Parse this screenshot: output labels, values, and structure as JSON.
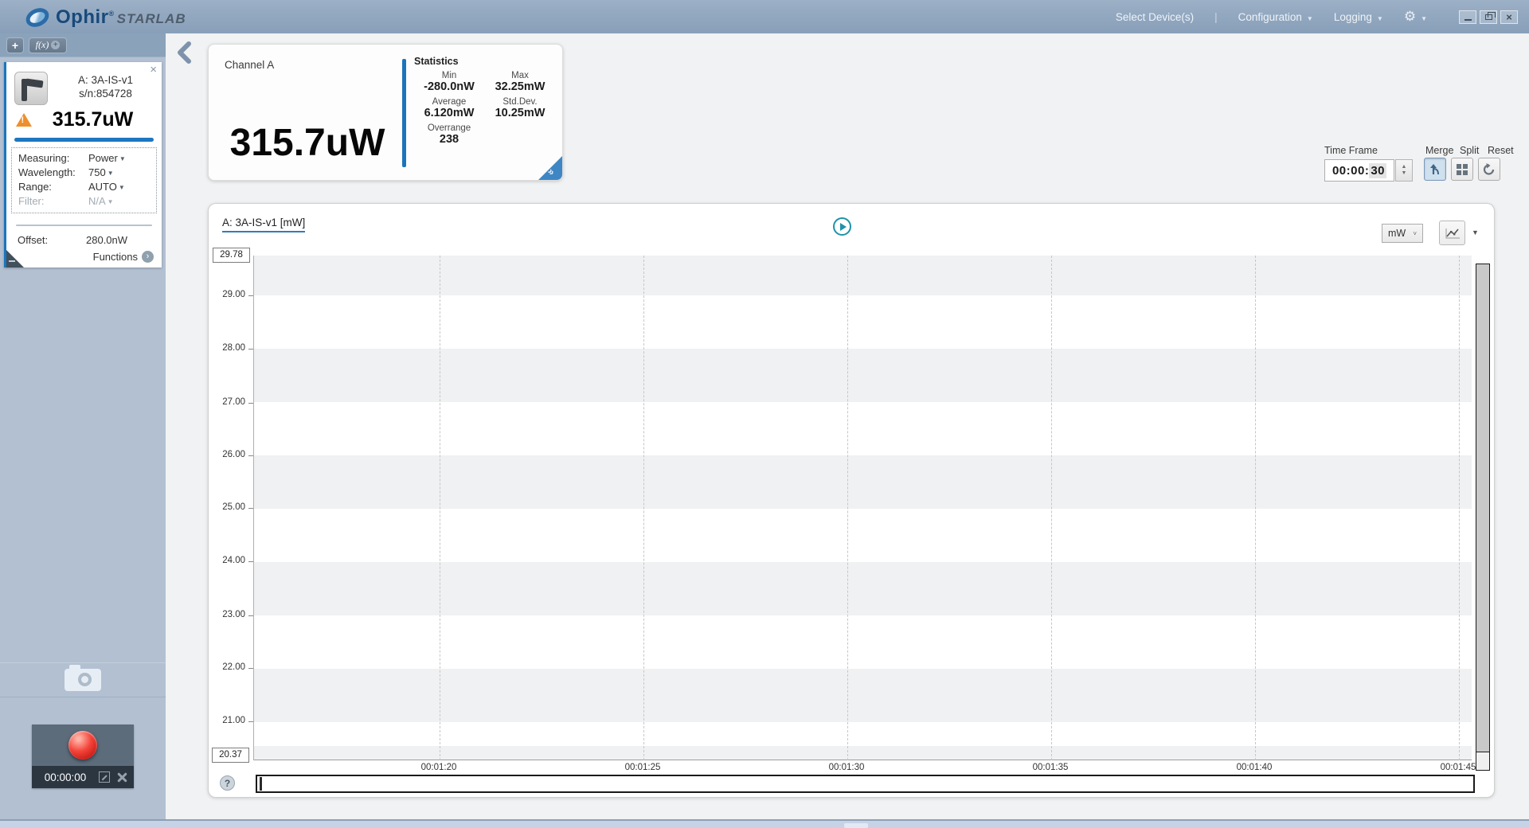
{
  "titlebar": {
    "brand": "Ophir",
    "registered": "®",
    "brand_sub": "STARLAB",
    "select_devices": "Select Device(s)",
    "separator": "|",
    "configuration": "Configuration",
    "logging": "Logging"
  },
  "icons": {
    "caret_down": "▼",
    "gear": "⚙",
    "close_window": "×",
    "chevron_right": "›",
    "plus": "+",
    "fx": "f(x)",
    "help": "?",
    "collapse_arrows": "»"
  },
  "sidebar": {
    "device": {
      "close": "×",
      "name": "A: 3A-IS-v1",
      "serial": "s/n:854728",
      "warning": "!",
      "reading": "315.7uW",
      "settings": [
        {
          "label": "Measuring:",
          "value": "Power"
        },
        {
          "label": "Wavelength:",
          "value": "750"
        },
        {
          "label": "Range:",
          "value": "AUTO"
        },
        {
          "label": "Filter:",
          "value": "N/A"
        }
      ],
      "offset_label": "Offset:",
      "offset_value": "280.0nW",
      "functions_label": "Functions"
    },
    "recorder": {
      "elapsed": "00:00:00"
    }
  },
  "main": {
    "channel_card": {
      "title": "Channel A",
      "reading": "315.7uW",
      "stats_title": "Statistics",
      "stats": [
        {
          "label": "Min",
          "value": "-280.0nW"
        },
        {
          "label": "Max",
          "value": "32.25mW"
        },
        {
          "label": "Average",
          "value": "6.120mW"
        },
        {
          "label": "Std.Dev.",
          "value": "10.25mW"
        },
        {
          "label": "Overrange",
          "value": "238"
        }
      ]
    },
    "timeframe": {
      "label": "Time Frame",
      "value_main": "00:00:",
      "value_seconds": "30",
      "merge_label": "Merge",
      "split_label": "Split",
      "reset_label": "Reset"
    },
    "chart": {
      "title": "A: 3A-IS-v1 [mW]",
      "unit": "mW"
    }
  },
  "chart_data": {
    "type": "line",
    "title": "A: 3A-IS-v1 [mW]",
    "ylabel": "mW",
    "ylim": [
      20.37,
      29.78
    ],
    "y_max_label": "29.78",
    "y_min_label": "20.37",
    "y_ticks": [
      "29.00",
      "28.00",
      "27.00",
      "26.00",
      "25.00",
      "24.00",
      "23.00",
      "22.00",
      "21.00"
    ],
    "x_ticks": [
      "00:01:20",
      "00:01:25",
      "00:01:30",
      "00:01:35",
      "00:01:40",
      "00:01:45"
    ],
    "series": [],
    "grid": "horizontal bands + vertical dashed time gridlines",
    "legend": "none"
  },
  "colors": {
    "titlebar": "#8ea5bd",
    "sidebar": "#b2c0d2",
    "accent_blue": "#1b75bc",
    "teal_play": "#1d93a8",
    "warning_orange": "#ef8f2b",
    "record_red": "#e02318",
    "band_gray": "#f0f1f2"
  }
}
